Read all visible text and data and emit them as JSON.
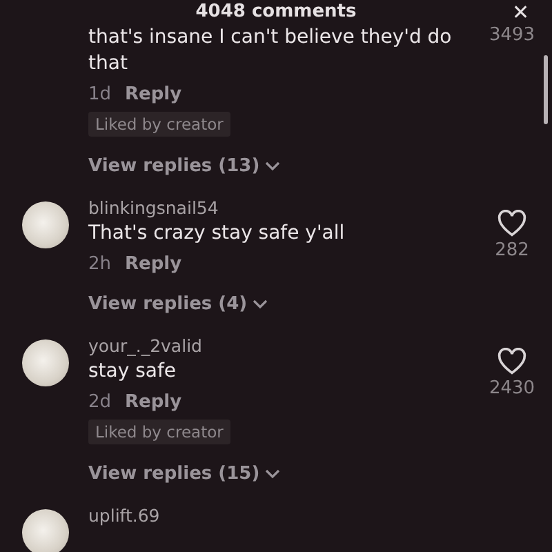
{
  "header": {
    "title": "4048 comments",
    "close": "✕"
  },
  "comments": [
    {
      "kind": "cut",
      "text": "that's insane I can't believe they'd do that",
      "time": "1d",
      "reply": "Reply",
      "liked_by_creator": true,
      "badge": "Liked by creator",
      "replies": "View replies (13)",
      "likes": "3493"
    },
    {
      "kind": "full",
      "username": "blinkingsnail54",
      "text": "That's crazy stay safe y'all",
      "time": "2h",
      "reply": "Reply",
      "liked_by_creator": false,
      "replies": "View replies (4)",
      "likes": "282"
    },
    {
      "kind": "full",
      "username": "your_._2valid",
      "text": "stay safe",
      "time": "2d",
      "reply": "Reply",
      "liked_by_creator": true,
      "badge": "Liked by creator",
      "replies": "View replies (15)",
      "likes": "2430"
    },
    {
      "kind": "head",
      "username": "uplift.69"
    }
  ]
}
